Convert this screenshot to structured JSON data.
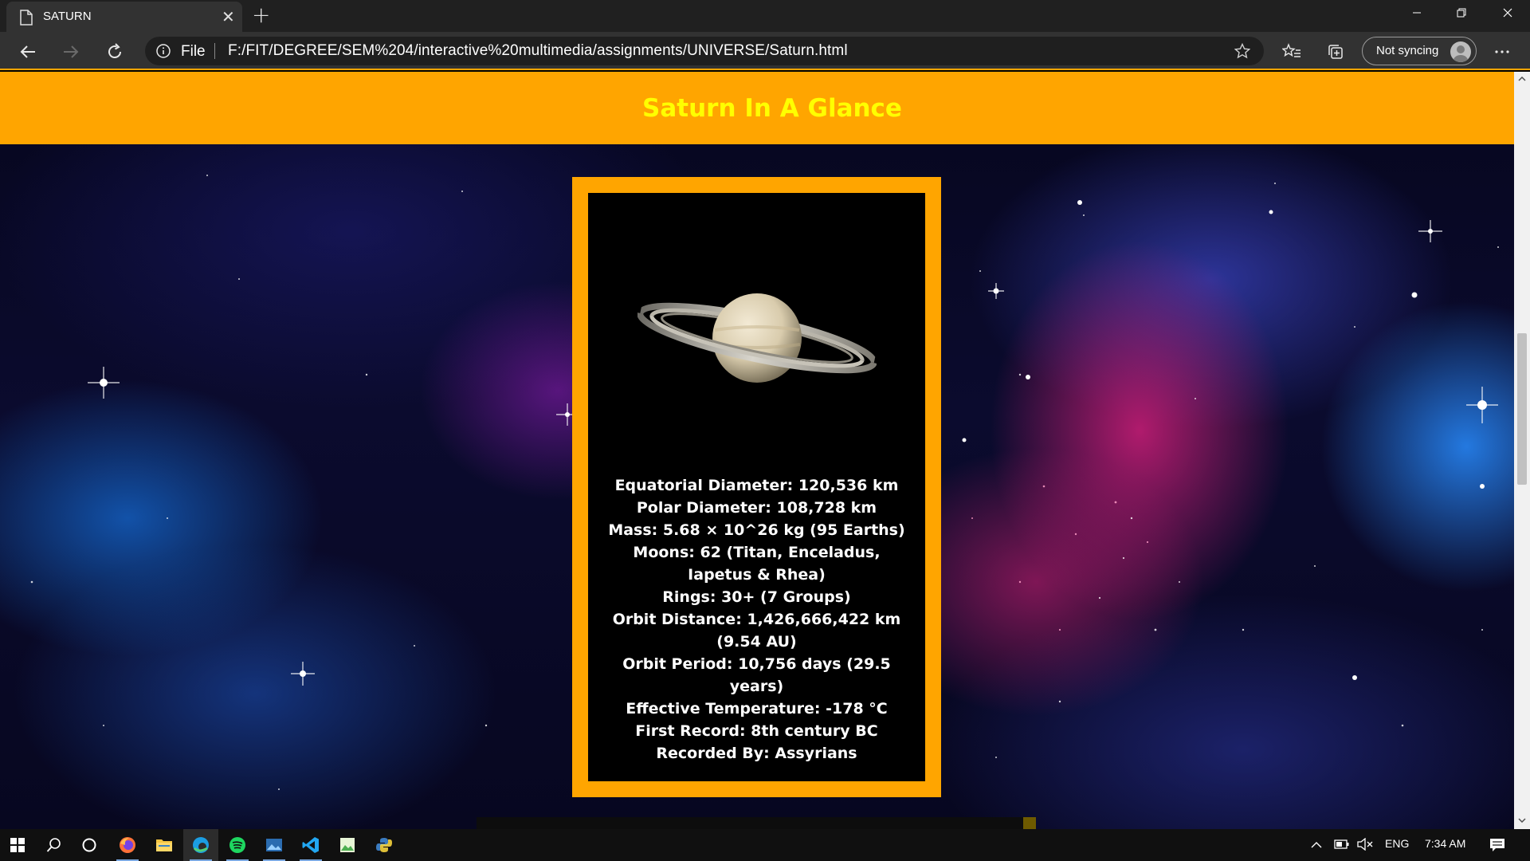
{
  "browser": {
    "tab_title": "SATURN",
    "address_scheme": "File",
    "url": "F:/FIT/DEGREE/SEM%204/interactive%20multimedia/assignments/UNIVERSE/Saturn.html",
    "profile_status": "Not syncing",
    "accent_color": "#ffa500"
  },
  "page": {
    "banner_title": "Saturn In A Glance",
    "banner_color": "#ffa500",
    "title_color": "#ffff00",
    "facts": [
      "Equatorial Diameter: 120,536 km",
      "Polar Diameter: 108,728 km",
      "Mass: 5.68 × 10^26 kg (95 Earths)",
      "Moons: 62 (Titan, Enceladus, Iapetus & Rhea)",
      "Rings: 30+ (7 Groups)",
      "Orbit Distance: 1,426,666,422 km (9.54 AU)",
      "Orbit Period: 10,756 days (29.5 years)",
      "Effective Temperature: -178 °C",
      "First Record: 8th century BC",
      "Recorded By: Assyrians"
    ]
  },
  "taskbar": {
    "apps": [
      "windows-start",
      "search",
      "cortana",
      "firefox",
      "file-explorer",
      "edge",
      "spotify",
      "photos",
      "vscode",
      "image-editor",
      "python-idle"
    ],
    "language": "ENG",
    "time": "7:34 AM"
  }
}
